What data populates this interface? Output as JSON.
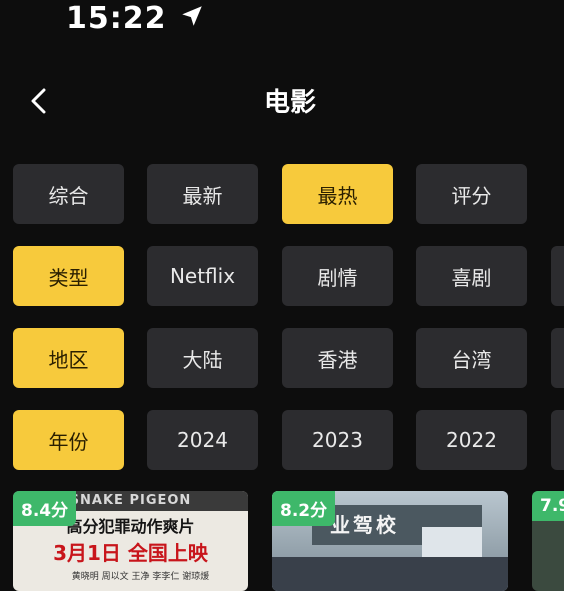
{
  "status": {
    "time": "15:22",
    "location_icon": "location-arrow-icon"
  },
  "header": {
    "title": "电影",
    "back_icon": "chevron-left-icon"
  },
  "filters": {
    "sort": [
      "综合",
      "最新",
      "最热",
      "评分"
    ],
    "type": [
      "类型",
      "Netflix",
      "剧情",
      "喜剧"
    ],
    "region": [
      "地区",
      "大陆",
      "香港",
      "台湾"
    ],
    "year": [
      "年份",
      "2024",
      "2023",
      "2022"
    ],
    "selected": {
      "sort": "最热",
      "type": "类型",
      "region": "地区",
      "year": "年份"
    }
  },
  "movies": [
    {
      "score": "8.4分",
      "poster_title": "SNAKE PIGEON",
      "tagline": "高分犯罪动作爽片",
      "release": "3月1日 全国上映",
      "credits": "黄晓明 周以文 王净 李李仁 谢琼煖"
    },
    {
      "score": "8.2分",
      "sign": "业驾校"
    },
    {
      "score": "7.9"
    }
  ],
  "colors": {
    "background": "#0d0d0d",
    "chip": "#2c2c2f",
    "selected_chip": "#f7ca3c",
    "score_badge": "#3eb86a"
  }
}
